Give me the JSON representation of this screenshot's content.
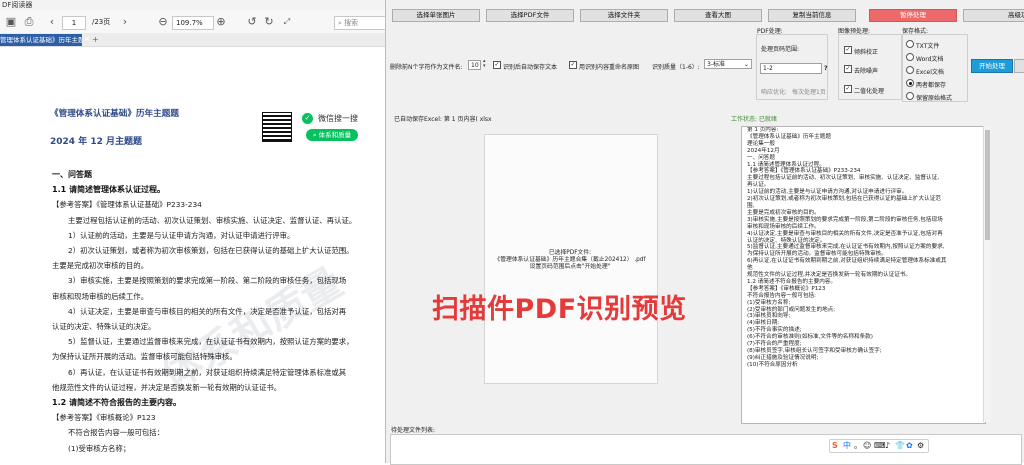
{
  "reader": {
    "title": "DF阅读器",
    "tab_label": "管理体系认证基础》历年主题",
    "page_current": "1",
    "page_total": "/23页",
    "zoom": "109.7%",
    "search_placeholder": "搜索",
    "doc_title": "《管理体系认证基础》历年主题题",
    "doc_subtitle": "2024 年 12 月主题题",
    "wechat_label": "微信搜一搜",
    "wechat_search_button": "体系和质量",
    "body": [
      {
        "kind": "head",
        "text": "一、问答题"
      },
      {
        "kind": "head",
        "text": "1.1 请简述管理体系认证过程。"
      },
      {
        "kind": "line",
        "text": "【参考答案】《管理体系认证基础》P233-234"
      },
      {
        "kind": "line",
        "text": "主要过程包括认证前的活动、初次认证策划、审核实施、认证决定、监督认证、再认证。"
      },
      {
        "kind": "line",
        "text": "1）认证前的活动，主要是与认证申请方沟通，对认证申请进行评审。"
      },
      {
        "kind": "line",
        "text": "2）初次认证策划，或者称为初次审核策划，包括在已获得认证的基础上扩大认证范围。"
      },
      {
        "kind": "line",
        "text": "主要是完成初次审核的目的。"
      },
      {
        "kind": "line",
        "text": "3）审核实施，主要是按照策划的要求完成第一阶段、第二阶段的审核任务，包括现场"
      },
      {
        "kind": "line",
        "text": "审核和现场审核的后续工作。"
      },
      {
        "kind": "line",
        "text": "4）认证决定，主要是审查与审核目的相关的所有文件，决定是否准予认证，包括对再"
      },
      {
        "kind": "line",
        "text": "认证的决定、特殊认证的决定。"
      },
      {
        "kind": "line",
        "text": "5）监督认证，主要通过监督审核来完成，在认证证书有效期内，按照认证方案的要求，"
      },
      {
        "kind": "line",
        "text": "为保持认证所开展的活动。监督审核可能包括特殊审核。"
      },
      {
        "kind": "line",
        "text": "6）再认证，在认证证书有效期到期之前，对获证组织持续满足特定管理体系标准或其"
      },
      {
        "kind": "line",
        "text": "他规范性文件的认证过程，并决定是否换发新一轮有效期的认证证书。"
      },
      {
        "kind": "head",
        "text": "1.2 请简述不符合报告的主要内容。"
      },
      {
        "kind": "line",
        "text": "【参考答案】《审核概论》P123"
      },
      {
        "kind": "line",
        "text": "不符合报告内容一般可包括："
      },
      {
        "kind": "line",
        "text": "(1)受审核方名称；"
      }
    ]
  },
  "app": {
    "buttons": [
      "选择单张图片",
      "选择PDF文件",
      "选择文件夹",
      "查看大图",
      "复制当前信息",
      "暂停处理",
      "高级功能"
    ],
    "rename_label": "删除前N个字符作为文件名:",
    "rename_value": "10",
    "auto_save_label": "识别后自动保存文本",
    "origin_name_label": "用识别内容重命名原图",
    "quality_label": "识别质量（1-6）:",
    "quality_value": "3-标准",
    "pdf_group_label": "PDF处理:",
    "page_range_label": "处理页码范围:",
    "page_range_value": "1-2",
    "help_mark": "?",
    "optimize_label": "响应优化:",
    "optimize_hint": "每次处理1页",
    "preprocess_label": "图像预处理:",
    "preprocess_options": [
      {
        "label": "倾斜校正",
        "checked": true
      },
      {
        "label": "去除噪声",
        "checked": true
      },
      {
        "label": "二值化处理",
        "checked": true
      }
    ],
    "save_format_label": "保存格式:",
    "save_options": [
      {
        "label": "TXT文件",
        "selected": false
      },
      {
        "label": "Word文档",
        "selected": false
      },
      {
        "label": "Excel文档",
        "selected": false
      },
      {
        "label": "两者都保存",
        "selected": true
      },
      {
        "label": "保留原始格式",
        "selected": false
      }
    ],
    "start_button": "开始处理",
    "autosave_status": "已自动保存Excel: 第 1 页内容( xlsx",
    "work_status": "工作状态: 已就绪",
    "preview_title": "扫描件PDF识别预览",
    "preview_caption": [
      "已选择PDF文件:",
      "《管理体系认证基础》历年主题合集（截止202412） .pdf",
      "设置页码范围后点击\"开始处理\""
    ],
    "result_lines": [
      "第 1 页内容:",
      "《管理体系认证基础》历年主题题",
      "理论集一般",
      "2024年12月",
      "一、问答题",
      "1.1 请简述管理体系认证过程。",
      "【参考答案】《管理体系认证基础》P233-234",
      "主要过程包括认证前的活动、初次认证策划、审核实施、认证决定、监督认证、",
      "再认证。",
      "1)认证前的活动,主要是与认证申请方沟通,对认证申请进行评审。",
      "2)初次认证策划,或者称为初次审核策划,包括在已获得认证的基础上扩大认证范",
      "围,",
      "主要是完成初次审核的目的。",
      "3)审核实施,主要是按照策划的要求完成第一阶段,第二阶段的审核任务,包括现场",
      "审核和现场审核的后续工作。",
      "4)认证决定,主要是审查与审核目的相关的所有文件,决定是否准予认证,包括对再",
      "认证的决定、特殊认证的决定。",
      "5)监督认证,主要通过监督审核来完成,在认证证书有效期内,按照认证方案的要求,",
      "为保持认证所开展的活动。监督审核可能包括特殊审核。",
      "6)再认证,在认证证书有效期到期之前,对获证组织持续满足特定管理体系标准或其",
      "他",
      "规范性文件的认证过程,并决定是否换发新一轮有效期的认证证书。",
      "1.2 请简述不符合报告的主要内容。",
      "【参考答案】《审核概论》P123",
      "不符合报告内容一般可包括:",
      "(1)受审核方名称;",
      "(2)受审核的部门或问题发生的地点;",
      "(3)审核员和向导;",
      "(4)审核日期;",
      "(5)不符合事实的描述;",
      "(6)不符合的审核准则(如标准,文件等的名称和条款)",
      "(7)不符合的严重程度;",
      "(8)审核员签字,审核组长认可签字和受审核方确认签字;",
      "(9)纠正措施及验证情况说明;",
      "(10)不符合原因分析"
    ],
    "pending_label": "待处理文件列表:",
    "ime": [
      "S",
      "中",
      "。",
      "☺",
      "⌨",
      "♪",
      "👕",
      "✿",
      "⚙"
    ]
  }
}
